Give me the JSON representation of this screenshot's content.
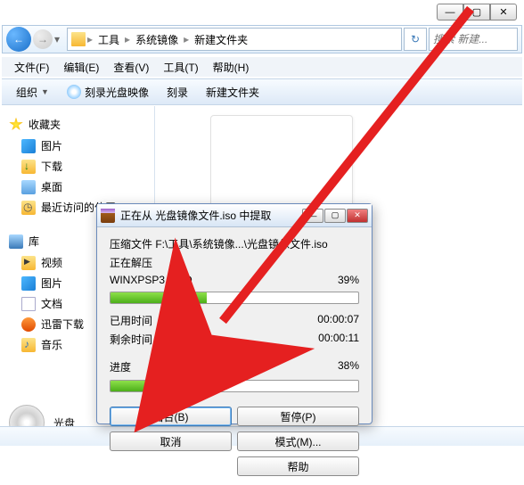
{
  "window": {
    "minimize": "—",
    "maximize": "▢",
    "close": "✕"
  },
  "nav": {
    "back": "←",
    "forward": "→",
    "dropdown": "▾",
    "refresh": "↻",
    "search_placeholder": "搜索 新建..."
  },
  "breadcrumb": {
    "sep": "▸",
    "root": "",
    "items": [
      "工具",
      "系统镜像",
      "新建文件夹"
    ]
  },
  "menu": {
    "file": "文件(F)",
    "edit": "编辑(E)",
    "view": "查看(V)",
    "tools": "工具(T)",
    "help": "帮助(H)"
  },
  "toolbar": {
    "organize": "组织",
    "burn_image": "刻录光盘映像",
    "burn": "刻录",
    "new_folder": "新建文件夹"
  },
  "sidebar": {
    "favorites": "收藏夹",
    "fav_items": [
      "图片",
      "下载",
      "桌面",
      "最近访问的位置"
    ],
    "libraries": "库",
    "lib_items": [
      "视频",
      "图片",
      "文档",
      "迅雷下载",
      "音乐"
    ]
  },
  "main": {
    "selected_file": "光盘"
  },
  "dialog": {
    "title": "正在从 光盘镜像文件.iso 中提取",
    "min": "—",
    "max": "▢",
    "close": "✕",
    "file_line": "压缩文件 F:\\工具\\系统镜像...\\光盘镜像文件.iso",
    "extracting": "正在解压",
    "current_file": "WINXPSP3.GHO",
    "current_pct": "39%",
    "elapsed_label": "已用时间",
    "elapsed_value": "00:00:07",
    "remaining_label": "剩余时间",
    "remaining_value": "00:00:11",
    "progress_label": "进度",
    "progress_pct": "38%",
    "btn_background": "后台(B)",
    "btn_pause": "暂停(P)",
    "btn_cancel": "取消",
    "btn_mode": "模式(M)...",
    "btn_help": "帮助"
  }
}
